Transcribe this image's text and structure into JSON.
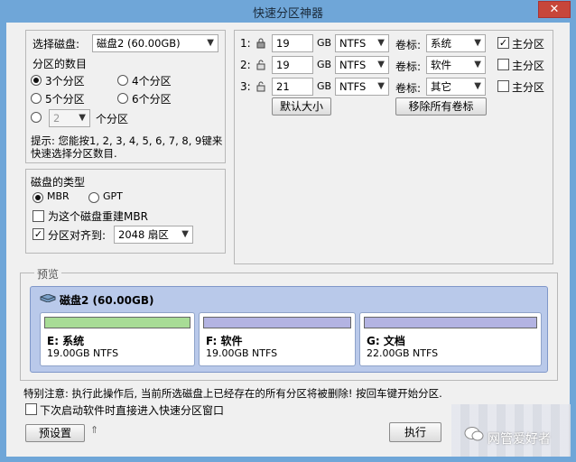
{
  "window": {
    "title": "快速分区神器",
    "close_glyph": "✕"
  },
  "disk_select": {
    "label": "选择磁盘:",
    "value": "磁盘2 (60.00GB)"
  },
  "partition_count": {
    "label": "分区的数目",
    "options": [
      "3个分区",
      "4个分区",
      "5个分区",
      "6个分区"
    ],
    "selected": "3个分区",
    "custom_value": "2",
    "custom_suffix": "个分区",
    "hint_line1": "提示: 您能按1, 2, 3, 4, 5, 6, 7, 8, 9键来",
    "hint_line2": "快速选择分区数目."
  },
  "disk_type": {
    "label": "磁盘的类型",
    "mbr": "MBR",
    "gpt": "GPT",
    "selected": "MBR",
    "rebuild_mbr": "为这个磁盘重建MBR",
    "rebuild_checked": false,
    "align_label": "分区对齐到:",
    "align_checked": true,
    "align_value": "2048 扇区"
  },
  "partitions": [
    {
      "index": "1:",
      "size": "19",
      "unit": "GB",
      "fs": "NTFS",
      "vol_label_text": "卷标:",
      "vol": "系统",
      "primary_label": "主分区",
      "primary": true,
      "locked": true
    },
    {
      "index": "2:",
      "size": "19",
      "unit": "GB",
      "fs": "NTFS",
      "vol_label_text": "卷标:",
      "vol": "软件",
      "primary_label": "主分区",
      "primary": false,
      "locked": false
    },
    {
      "index": "3:",
      "size": "21",
      "unit": "GB",
      "fs": "NTFS",
      "vol_label_text": "卷标:",
      "vol": "其它",
      "primary_label": "主分区",
      "primary": false,
      "locked": false
    }
  ],
  "buttons": {
    "default_size": "默认大小",
    "remove_labels": "移除所有卷标",
    "preset": "预设置",
    "execute": "执行"
  },
  "preview": {
    "legend": "预览",
    "disk_title": "磁盘2 (60.00GB)",
    "parts": [
      {
        "name": "E: 系统",
        "size": "19.00GB NTFS",
        "color": "#a8dc96"
      },
      {
        "name": "F: 软件",
        "size": "19.00GB NTFS",
        "color": "#b3b3e2"
      },
      {
        "name": "G: 文档",
        "size": "22.00GB NTFS",
        "color": "#b3b3e2"
      }
    ]
  },
  "notice": "特别注意: 执行此操作后, 当前所选磁盘上已经存在的所有分区将被删除! 按回车键开始分区.",
  "startup_option": {
    "label": "下次启动软件时直接进入快速分区窗口",
    "checked": false
  },
  "watermark": {
    "text": "网管爱好者"
  },
  "colors": {
    "titlebar": "#6fa6d8",
    "close": "#c7463a",
    "preview_bg": "#b9c9ea",
    "primary_bar": "#a8dc96",
    "logical_bar": "#b3b3e2"
  }
}
